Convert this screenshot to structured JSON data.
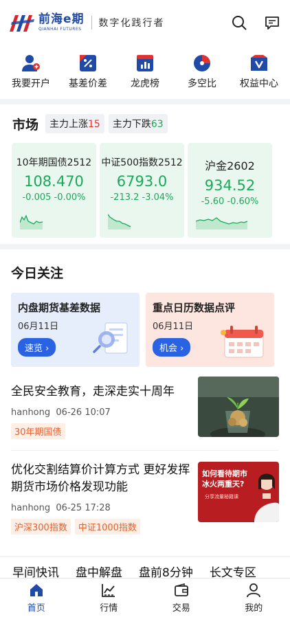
{
  "header": {
    "brand_cn": "前海e期",
    "brand_en": "QIANHAI FUTURES",
    "slogan": "数字化践行者",
    "icons": [
      "search-icon",
      "message-icon"
    ]
  },
  "quick_nav": [
    {
      "label": "我要开户",
      "icon": "user-add-icon"
    },
    {
      "label": "基差价差",
      "icon": "percent-icon"
    },
    {
      "label": "龙虎榜",
      "icon": "chart-board-icon"
    },
    {
      "label": "多空比",
      "icon": "pie-icon"
    },
    {
      "label": "权益中心",
      "icon": "vip-icon"
    }
  ],
  "market": {
    "title": "市场",
    "up_label": "主力上涨",
    "up_count": "15",
    "down_label": "主力下跌",
    "down_count": "63",
    "cards": [
      {
        "name": "10年期国债2512",
        "price": "108.470",
        "change": "-0.005 -0.00%"
      },
      {
        "name": "中证500指数2512",
        "price": "6793.0",
        "change": "-213.2 -3.04%"
      },
      {
        "name": "沪金2602",
        "price": "934.52",
        "change": "-5.60 -0.60%"
      }
    ]
  },
  "focus": {
    "title": "今日关注",
    "banners": [
      {
        "title": "内盘期货基差数据",
        "date": "06月11日",
        "button": "速览 ›"
      },
      {
        "title": "重点日历数据点评",
        "date": "06月11日",
        "button": "机会 ›"
      }
    ],
    "news": [
      {
        "headline": "全民安全教育，走深走实十周年",
        "author": "hanhong",
        "time": "06-26 10:07",
        "tags": [
          "30年期国债"
        ]
      },
      {
        "headline": "优化交割结算价计算方式 更好发挥期货市场价格发现功能",
        "author": "hanhong",
        "time": "06-25 17:28",
        "tags": [
          "沪深300指数",
          "中证1000指数"
        ],
        "thumb_text": "如何看待期市冰火两重天?",
        "thumb_sub": "分享流量秘籍课"
      }
    ]
  },
  "content_tabs": [
    "早间快讯",
    "盘中解盘",
    "盘前8分钟",
    "长文专区"
  ],
  "tabbar": [
    {
      "label": "首页",
      "icon": "home-icon",
      "active": true
    },
    {
      "label": "行情",
      "icon": "market-chart-icon",
      "active": false
    },
    {
      "label": "交易",
      "icon": "wallet-icon",
      "active": false
    },
    {
      "label": "我的",
      "icon": "profile-icon",
      "active": false
    }
  ],
  "colors": {
    "brand": "#1f4aa8",
    "up": "#e0322f",
    "down": "#1aa85a",
    "accent": "#2a62e4",
    "tag": "#e7602b"
  }
}
